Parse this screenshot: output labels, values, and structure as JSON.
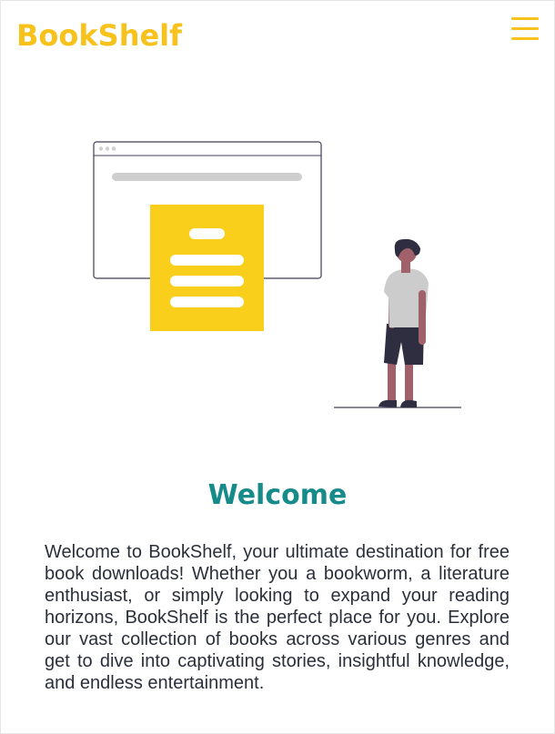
{
  "header": {
    "logo": "BookShelf",
    "menu_icon": "hamburger-menu-icon"
  },
  "hero": {
    "illustration": "person-viewing-web-page-illustration",
    "colors": {
      "accent": "#f9cf1c",
      "outline": "#3f3d56",
      "skeleton": "#cfcfcf",
      "skin": "#a0616a",
      "hair": "#2f2e41",
      "shirt": "#cccccc"
    }
  },
  "welcome": {
    "title": "Welcome",
    "body": "Welcome to BookShelf, your ultimate destination for free book downloads! Whether you a bookworm, a literature enthusiast, or simply looking to expand your reading horizons, BookShelf is the perfect place for you. Explore our vast collection of books across various genres and get to dive into captivating stories, insightful knowledge, and endless entertainment."
  },
  "colors": {
    "brand": "#f7c21c",
    "title": "#178a8a",
    "text": "#2a2f3a",
    "background": "#ffffff"
  }
}
